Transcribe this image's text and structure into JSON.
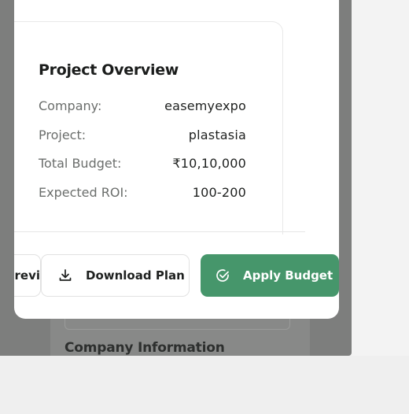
{
  "background": {
    "section_heading": "Company Information"
  },
  "modal": {
    "card": {
      "title": "Project Overview",
      "rows": [
        {
          "label": "Company:",
          "value": "easemyexpo"
        },
        {
          "label": "Project:",
          "value": "plastasia"
        },
        {
          "label": "Total Budget:",
          "value": "₹10,10,000"
        },
        {
          "label": "Expected ROI:",
          "value": "100-200"
        }
      ]
    },
    "actions": {
      "previous_label": "Previ",
      "download_label": "Download Plan",
      "download_icon": "download-icon",
      "apply_label": "Apply Budget",
      "apply_icon": "check-circle-icon"
    }
  },
  "colors": {
    "accent": "#46966b",
    "overlay": "#7d7e7d"
  }
}
